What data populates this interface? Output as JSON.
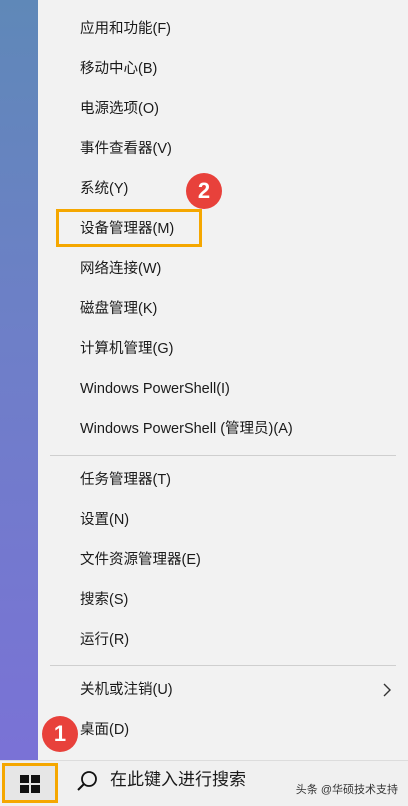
{
  "menu": {
    "items": [
      {
        "label": "应用和功能(F)"
      },
      {
        "label": "移动中心(B)"
      },
      {
        "label": "电源选项(O)"
      },
      {
        "label": "事件查看器(V)"
      },
      {
        "label": "系统(Y)"
      },
      {
        "label": "设备管理器(M)"
      },
      {
        "label": "网络连接(W)"
      },
      {
        "label": "磁盘管理(K)"
      },
      {
        "label": "计算机管理(G)"
      },
      {
        "label": "Windows PowerShell(I)"
      },
      {
        "label": "Windows PowerShell (管理员)(A)"
      },
      {
        "label": "任务管理器(T)"
      },
      {
        "label": "设置(N)"
      },
      {
        "label": "文件资源管理器(E)"
      },
      {
        "label": "搜索(S)"
      },
      {
        "label": "运行(R)"
      },
      {
        "label": "关机或注销(U)"
      },
      {
        "label": "桌面(D)"
      }
    ]
  },
  "annotations": {
    "step1": "1",
    "step2": "2",
    "highlight_color": "#f5a700",
    "badge_color": "#e8413b"
  },
  "taskbar": {
    "search_placeholder": "在此键入进行搜索",
    "start_icon": "windows-logo-icon",
    "search_icon": "search-icon"
  },
  "watermark": "头条 @华硕技术支持"
}
